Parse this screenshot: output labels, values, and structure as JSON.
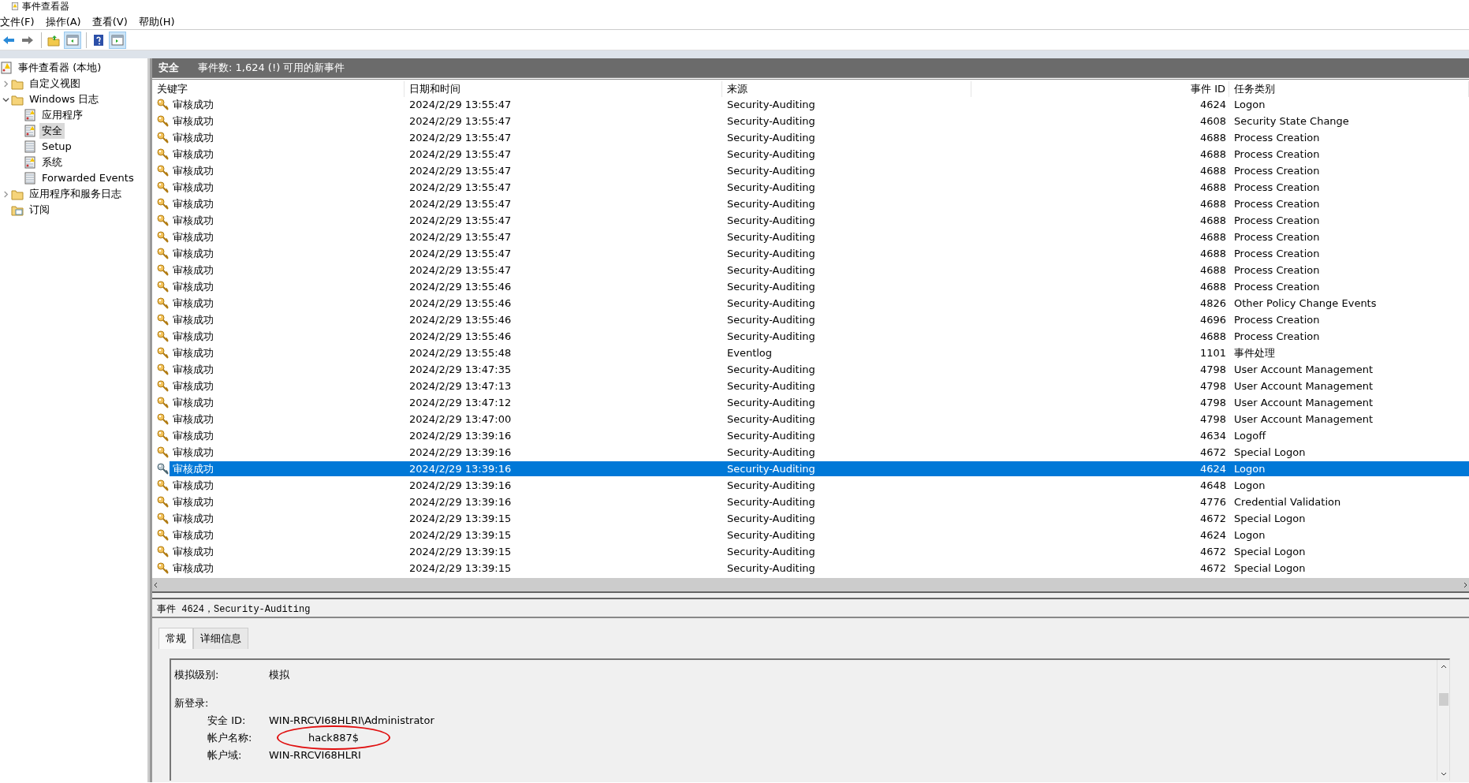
{
  "window": {
    "title": "事件查看器"
  },
  "menu": [
    "文件(F)",
    "操作(A)",
    "查看(V)",
    "帮助(H)"
  ],
  "toolbar": [
    {
      "kind": "back"
    },
    {
      "kind": "forward"
    },
    {
      "kind": "sep"
    },
    {
      "kind": "folder-up"
    },
    {
      "kind": "pane",
      "selected": true
    },
    {
      "kind": "sep"
    },
    {
      "kind": "help"
    },
    {
      "kind": "pane-right",
      "selected": true
    }
  ],
  "tree": [
    {
      "label": "事件查看器 (本地)",
      "kind": "root",
      "selected": false,
      "children": [
        {
          "label": "自定义视图",
          "kind": "folder",
          "expanded": false,
          "selected": false
        },
        {
          "label": "Windows 日志",
          "kind": "folder",
          "expanded": true,
          "selected": false,
          "children": [
            {
              "label": "应用程序",
              "kind": "log-warn",
              "selected": false
            },
            {
              "label": "安全",
              "kind": "log-warn",
              "selected": true
            },
            {
              "label": "Setup",
              "kind": "log",
              "selected": false
            },
            {
              "label": "系统",
              "kind": "log-warn",
              "selected": false
            },
            {
              "label": "Forwarded Events",
              "kind": "log",
              "selected": false
            }
          ]
        },
        {
          "label": "应用程序和服务日志",
          "kind": "folder",
          "expanded": false,
          "selected": false
        },
        {
          "label": "订阅",
          "kind": "subscription",
          "selected": false
        }
      ]
    }
  ],
  "pane_header": {
    "title": "安全",
    "info": "事件数: 1,624 (!) 可用的新事件"
  },
  "table": {
    "columns": [
      "关键字",
      "日期和时间",
      "来源",
      "事件 ID",
      "任务类别"
    ],
    "rows": [
      {
        "keyword": "审核成功",
        "datetime": "2024/2/29 13:55:47",
        "source": "Security-Auditing",
        "event_id": "4624",
        "task": "Logon",
        "selected": false
      },
      {
        "keyword": "审核成功",
        "datetime": "2024/2/29 13:55:47",
        "source": "Security-Auditing",
        "event_id": "4608",
        "task": "Security State Change",
        "selected": false
      },
      {
        "keyword": "审核成功",
        "datetime": "2024/2/29 13:55:47",
        "source": "Security-Auditing",
        "event_id": "4688",
        "task": "Process Creation",
        "selected": false
      },
      {
        "keyword": "审核成功",
        "datetime": "2024/2/29 13:55:47",
        "source": "Security-Auditing",
        "event_id": "4688",
        "task": "Process Creation",
        "selected": false
      },
      {
        "keyword": "审核成功",
        "datetime": "2024/2/29 13:55:47",
        "source": "Security-Auditing",
        "event_id": "4688",
        "task": "Process Creation",
        "selected": false
      },
      {
        "keyword": "审核成功",
        "datetime": "2024/2/29 13:55:47",
        "source": "Security-Auditing",
        "event_id": "4688",
        "task": "Process Creation",
        "selected": false
      },
      {
        "keyword": "审核成功",
        "datetime": "2024/2/29 13:55:47",
        "source": "Security-Auditing",
        "event_id": "4688",
        "task": "Process Creation",
        "selected": false
      },
      {
        "keyword": "审核成功",
        "datetime": "2024/2/29 13:55:47",
        "source": "Security-Auditing",
        "event_id": "4688",
        "task": "Process Creation",
        "selected": false
      },
      {
        "keyword": "审核成功",
        "datetime": "2024/2/29 13:55:47",
        "source": "Security-Auditing",
        "event_id": "4688",
        "task": "Process Creation",
        "selected": false
      },
      {
        "keyword": "审核成功",
        "datetime": "2024/2/29 13:55:47",
        "source": "Security-Auditing",
        "event_id": "4688",
        "task": "Process Creation",
        "selected": false
      },
      {
        "keyword": "审核成功",
        "datetime": "2024/2/29 13:55:47",
        "source": "Security-Auditing",
        "event_id": "4688",
        "task": "Process Creation",
        "selected": false
      },
      {
        "keyword": "审核成功",
        "datetime": "2024/2/29 13:55:46",
        "source": "Security-Auditing",
        "event_id": "4688",
        "task": "Process Creation",
        "selected": false
      },
      {
        "keyword": "审核成功",
        "datetime": "2024/2/29 13:55:46",
        "source": "Security-Auditing",
        "event_id": "4826",
        "task": "Other Policy Change Events",
        "selected": false
      },
      {
        "keyword": "审核成功",
        "datetime": "2024/2/29 13:55:46",
        "source": "Security-Auditing",
        "event_id": "4696",
        "task": "Process Creation",
        "selected": false
      },
      {
        "keyword": "审核成功",
        "datetime": "2024/2/29 13:55:46",
        "source": "Security-Auditing",
        "event_id": "4688",
        "task": "Process Creation",
        "selected": false
      },
      {
        "keyword": "审核成功",
        "datetime": "2024/2/29 13:55:48",
        "source": "Eventlog",
        "event_id": "1101",
        "task": "事件处理",
        "selected": false
      },
      {
        "keyword": "审核成功",
        "datetime": "2024/2/29 13:47:35",
        "source": "Security-Auditing",
        "event_id": "4798",
        "task": "User Account Management",
        "selected": false
      },
      {
        "keyword": "审核成功",
        "datetime": "2024/2/29 13:47:13",
        "source": "Security-Auditing",
        "event_id": "4798",
        "task": "User Account Management",
        "selected": false
      },
      {
        "keyword": "审核成功",
        "datetime": "2024/2/29 13:47:12",
        "source": "Security-Auditing",
        "event_id": "4798",
        "task": "User Account Management",
        "selected": false
      },
      {
        "keyword": "审核成功",
        "datetime": "2024/2/29 13:47:00",
        "source": "Security-Auditing",
        "event_id": "4798",
        "task": "User Account Management",
        "selected": false
      },
      {
        "keyword": "审核成功",
        "datetime": "2024/2/29 13:39:16",
        "source": "Security-Auditing",
        "event_id": "4634",
        "task": "Logoff",
        "selected": false
      },
      {
        "keyword": "审核成功",
        "datetime": "2024/2/29 13:39:16",
        "source": "Security-Auditing",
        "event_id": "4672",
        "task": "Special Logon",
        "selected": false
      },
      {
        "keyword": "审核成功",
        "datetime": "2024/2/29 13:39:16",
        "source": "Security-Auditing",
        "event_id": "4624",
        "task": "Logon",
        "selected": true
      },
      {
        "keyword": "审核成功",
        "datetime": "2024/2/29 13:39:16",
        "source": "Security-Auditing",
        "event_id": "4648",
        "task": "Logon",
        "selected": false
      },
      {
        "keyword": "审核成功",
        "datetime": "2024/2/29 13:39:16",
        "source": "Security-Auditing",
        "event_id": "4776",
        "task": "Credential Validation",
        "selected": false
      },
      {
        "keyword": "审核成功",
        "datetime": "2024/2/29 13:39:15",
        "source": "Security-Auditing",
        "event_id": "4672",
        "task": "Special Logon",
        "selected": false
      },
      {
        "keyword": "审核成功",
        "datetime": "2024/2/29 13:39:15",
        "source": "Security-Auditing",
        "event_id": "4624",
        "task": "Logon",
        "selected": false
      },
      {
        "keyword": "审核成功",
        "datetime": "2024/2/29 13:39:15",
        "source": "Security-Auditing",
        "event_id": "4672",
        "task": "Special Logon",
        "selected": false
      },
      {
        "keyword": "审核成功",
        "datetime": "2024/2/29 13:39:15",
        "source": "Security-Auditing",
        "event_id": "4672",
        "task": "Special Logon",
        "selected": false
      }
    ]
  },
  "details": {
    "title": "事件 4624，Security-Auditing",
    "tabs": [
      {
        "label": "常规",
        "selected": true
      },
      {
        "label": "详细信息",
        "selected": false
      }
    ],
    "fields": [
      {
        "kind": "field",
        "label": "模拟级别:",
        "value": "模拟",
        "circled": false
      },
      {
        "kind": "heading",
        "label": "新登录:"
      },
      {
        "kind": "subfield",
        "label": "安全 ID:",
        "value": "WIN-RRCVI68HLRI\\Administrator",
        "circled": false
      },
      {
        "kind": "subfield",
        "label": "帐户名称:",
        "value": "hack887$",
        "circled": true
      },
      {
        "kind": "subfield",
        "label": "帐户域:",
        "value": "WIN-RRCVI68HLRI",
        "circled": false
      }
    ]
  }
}
